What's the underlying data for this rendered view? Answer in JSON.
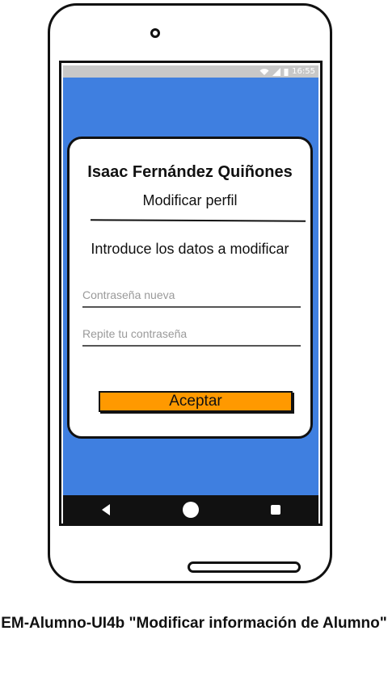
{
  "status_bar": {
    "time": "16:55"
  },
  "profile": {
    "name": "Isaac Fernández Quiñones",
    "subtitle": "Modificar perfil",
    "instruction": "Introduce los datos a modificar"
  },
  "form": {
    "new_password_placeholder": "Contraseña nueva",
    "repeat_password_placeholder": "Repite tu contraseña",
    "accept_label": "Aceptar",
    "accept_color": "#ff9900"
  },
  "theme": {
    "screen_bg": "#3f7fe0",
    "navbar_bg": "#111111"
  },
  "nav": {
    "icons": [
      "back-icon",
      "home-icon",
      "recents-icon"
    ]
  },
  "caption": "EM-Alumno-UI4b \"Modificar información de Alumno\""
}
